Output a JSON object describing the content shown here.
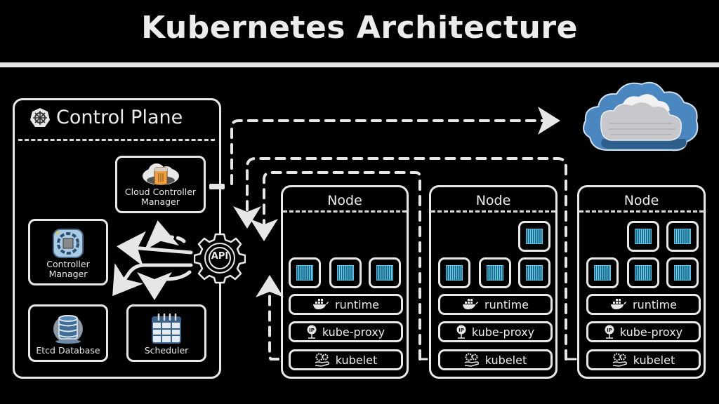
{
  "title": "Kubernetes Architecture",
  "control_plane": {
    "label": "Control Plane",
    "icon": "helm-wheel-icon",
    "components": [
      {
        "id": "ccm",
        "label_line1": "Cloud Controller",
        "label_line2": "Manager",
        "icon": "cloud-server-icon"
      },
      {
        "id": "cm",
        "label_line1": "Controller",
        "label_line2": "Manager",
        "icon": "controller-chip-icon"
      },
      {
        "id": "etcd",
        "label_line1": "Etcd Database",
        "label_line2": "",
        "icon": "database-icon"
      },
      {
        "id": "sched",
        "label_line1": "Scheduler",
        "label_line2": "",
        "icon": "calendar-icon"
      }
    ],
    "api": {
      "label": "API",
      "icon": "gear-icon"
    }
  },
  "cloud": {
    "icon": "cloud-provider-icon"
  },
  "nodes": [
    {
      "label": "Node",
      "pods_top_row": 0,
      "pods_bottom_row": 3
    },
    {
      "label": "Node",
      "pods_top_row": 1,
      "pods_bottom_row": 3
    },
    {
      "label": "Node",
      "pods_top_row": 2,
      "pods_bottom_row": 3
    }
  ],
  "node_services": {
    "runtime": {
      "label": "runtime",
      "icon": "docker-whale-icon"
    },
    "kube_proxy": {
      "label": "kube-proxy",
      "icon": "ip-pin-icon"
    },
    "kubelet": {
      "label": "kubelet",
      "icon": "gears-hand-icon"
    }
  },
  "colors": {
    "background": "#000000",
    "stroke": "#e8e8e8",
    "pod_fill": "#1f6f8f",
    "pod_line": "#6fd2f2",
    "cloud_blue": "#4a86c0",
    "ccm_orange": "#f0a040"
  }
}
